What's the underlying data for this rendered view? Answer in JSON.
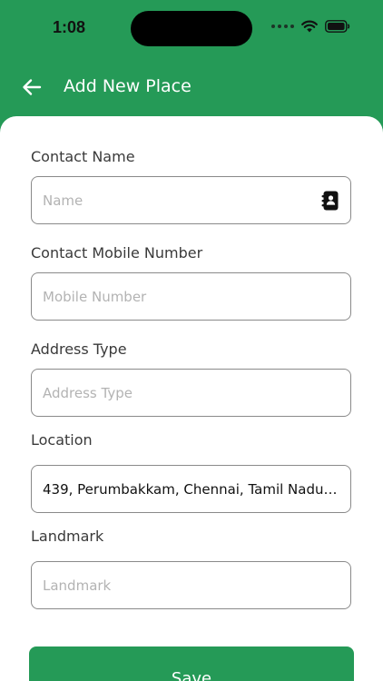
{
  "status_bar": {
    "time": "1:08"
  },
  "header": {
    "title": "Add New Place",
    "back_icon": "arrow-left-icon"
  },
  "form": {
    "contact_name": {
      "label": "Contact Name",
      "placeholder": "Name",
      "value": "",
      "icon": "contact-book-icon"
    },
    "mobile_number": {
      "label": "Contact Mobile Number",
      "placeholder": "Mobile Number",
      "value": ""
    },
    "address_type": {
      "label": "Address Type",
      "placeholder": "Address Type",
      "value": ""
    },
    "location": {
      "label": "Location",
      "value": "439, Perumbakkam, Chennai, Tamil Nadu…"
    },
    "landmark": {
      "label": "Landmark",
      "placeholder": "Landmark",
      "value": ""
    }
  },
  "save_label": "Save",
  "colors": {
    "primary": "#259A57",
    "card": "#FFFFFF",
    "border": "#8A8A8A",
    "placeholder": "#B3B3B3",
    "label": "#3A3A3A"
  }
}
